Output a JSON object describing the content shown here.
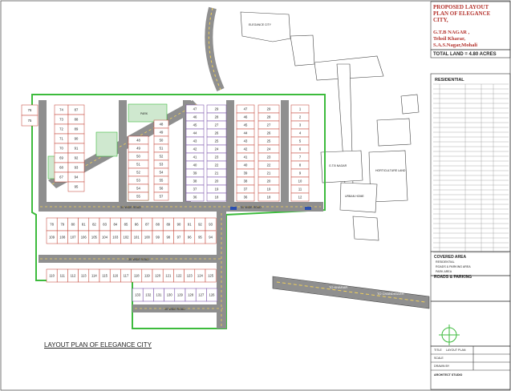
{
  "title_block": {
    "title": "PROPOSED LAYOUT\nPLAN OF ELEGANCE\nCITY,",
    "location": "G.T.B NAGAR ,\nTehsil Kharar,\nS.A.S.Nagar,Mohali",
    "total_land": "TOTAL LAND = 4.80 ACRES",
    "residential_heading": "RESIDENTIAL",
    "covered_area_heading": "COVERED AREA",
    "covered_lines": [
      "RESIDENTIAL",
      "ROADS & PARKING AREA",
      "PARK AREA"
    ],
    "roads_parking_heading": "ROADS & PARKING",
    "drawing_title_label": "TITLE",
    "drawing_title": "LAYOUT PLAN",
    "scale_label": "SCALE",
    "drawn_by_label": "DRAWN BY",
    "architect": "ARCHITECT STUDIO"
  },
  "caption": "LAYOUT PLAN OF ELEGANCE CITY",
  "labels": {
    "road_top_left": "30' WIDE ROAD",
    "road_top_right": "30' WIDE ROAD",
    "road_middle": "30' WIDE ROAD",
    "road_bottom": "30' WIDE ROAD",
    "park": "PARK",
    "road_vertical": "30' WIDE ROAD",
    "site_entrance": "TO KHARAR",
    "road_feature": "TO CHANDIGARH",
    "elegance_city": "ELEGANCE CITY",
    "horticulture": "HORTICULTURE LAND",
    "gtb_nagar": "G.T.B NAGAR",
    "urban_home": "URBAN HOME"
  },
  "plots": {
    "col_a": [
      "76",
      "75",
      "74",
      "73",
      "72",
      "71",
      "70",
      "69",
      "68",
      "67",
      "66",
      "65"
    ],
    "col_b": [
      "87",
      "88",
      "89",
      "90",
      "91",
      "92",
      "93",
      "94",
      "95",
      "96",
      "97",
      "98"
    ],
    "col_c": [
      "29",
      "28",
      "27",
      "26",
      "25",
      "24",
      "23",
      "22",
      "21",
      "20",
      "19",
      "18"
    ],
    "col_d": [
      "1",
      "2",
      "3",
      "4",
      "5",
      "6",
      "7",
      "8",
      "9",
      "10",
      "11",
      "12"
    ],
    "col_e": [
      "47",
      "46",
      "45",
      "44",
      "43",
      "42",
      "41",
      "40",
      "39",
      "38",
      "37",
      "36"
    ],
    "col_f": [
      "48",
      "49",
      "50",
      "51",
      "52",
      "53",
      "54",
      "55",
      "56",
      "57",
      "58",
      "59"
    ],
    "row_mid": [
      "78",
      "79",
      "80",
      "81",
      "82",
      "83",
      "84",
      "85",
      "86",
      "87",
      "88",
      "89",
      "90",
      "91",
      "92",
      "93"
    ],
    "row_mid_b": [
      "109",
      "108",
      "107",
      "106",
      "105",
      "104",
      "103",
      "102",
      "101",
      "100",
      "99",
      "98",
      "97",
      "96",
      "95",
      "94"
    ],
    "row_bottom": [
      "110",
      "111",
      "112",
      "113",
      "114",
      "115",
      "116",
      "117",
      "118",
      "119",
      "120",
      "121",
      "122",
      "123",
      "124",
      "125"
    ],
    "row_bottom_b": [
      "133",
      "132",
      "131",
      "130",
      "129",
      "128",
      "127",
      "126"
    ]
  },
  "colors": {
    "plot_line": "#c0392b",
    "plot_line_2": "#6b3fa0",
    "road": "#8f8f8f",
    "green": "#3dbb3d",
    "park": "#cfe8cf",
    "title_red": "#b4322c"
  }
}
